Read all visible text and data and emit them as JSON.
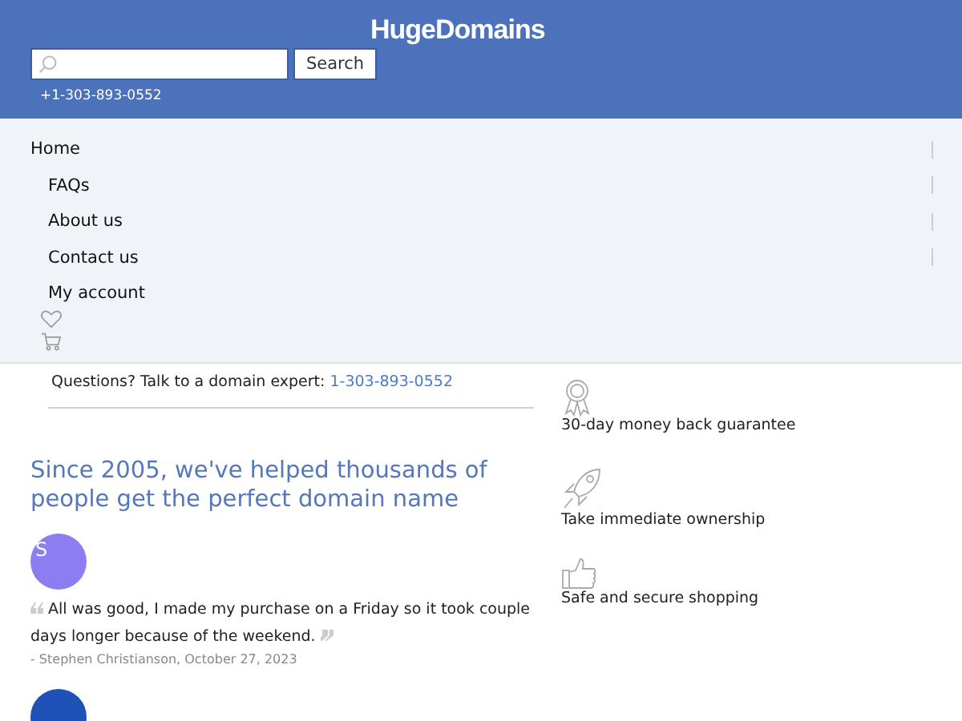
{
  "header": {
    "logo": "HugeDomains",
    "search": {
      "button": "Search"
    },
    "phone": "+1-303-893-0552"
  },
  "nav": [
    {
      "label": "Home",
      "kind": "top",
      "divider": true
    },
    {
      "label": "FAQs",
      "kind": "sub",
      "divider": true
    },
    {
      "label": "About us",
      "kind": "sub",
      "divider": true
    },
    {
      "label": "Contact us",
      "kind": "sub",
      "divider": true
    },
    {
      "label": "My account",
      "kind": "sub",
      "divider": false
    }
  ],
  "contact": {
    "text": "Questions? Talk to a domain expert:",
    "phone": "1-303-893-0552"
  },
  "features": [
    {
      "kind": "ribbon",
      "label": "30-day money back guarantee"
    },
    {
      "kind": "rocket",
      "label": "Take immediate ownership"
    },
    {
      "kind": "thumb",
      "label": "Safe and secure shopping"
    }
  ],
  "headline": "Since 2005, we've helped thousands of people get the perfect domain name",
  "reviews": [
    {
      "initial": "S",
      "color": "#8c7df2",
      "quote": "All was good, I made my purchase on a Friday so it took couple days longer because of the weekend.",
      "author": "- Stephen Christianson, October 27, 2023"
    },
    {
      "color": "#1f52b8"
    }
  ]
}
